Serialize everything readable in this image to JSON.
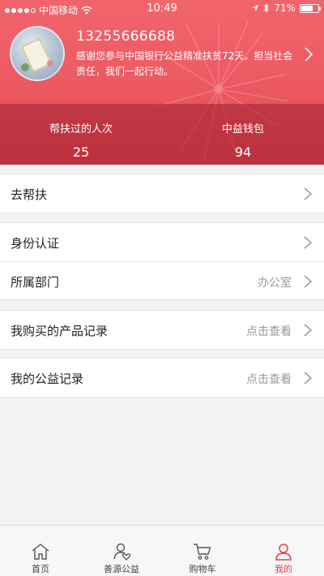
{
  "status_bar": {
    "carrier": "中国移动",
    "time": "10:49",
    "battery": "71%",
    "battery_level": 0.71
  },
  "profile": {
    "phone": "13255666688",
    "message": "感谢您参与中国银行公益精准扶贫72天。担当社会责任，我们一起行动。"
  },
  "stats": [
    {
      "label": "帮扶过的人次",
      "value": "25"
    },
    {
      "label": "中益钱包",
      "value": "94"
    }
  ],
  "menu": {
    "help": {
      "label": "去帮扶"
    },
    "identity": {
      "label": "身份认证"
    },
    "department": {
      "label": "所属部门",
      "value": "办公室"
    },
    "purchases": {
      "label": "我购买的产品记录",
      "action": "点击查看"
    },
    "charity": {
      "label": "我的公益记录",
      "action": "点击查看"
    }
  },
  "tabbar": {
    "items": [
      {
        "label": "首页",
        "icon": "home-icon"
      },
      {
        "label": "善源公益",
        "icon": "charity-heart-person-icon"
      },
      {
        "label": "购物车",
        "icon": "cart-icon"
      },
      {
        "label": "我的",
        "icon": "person-icon"
      }
    ],
    "active_index": 3,
    "active_color": "#e8394a"
  },
  "colors": {
    "header_red": "#ee5c65",
    "stats_overlay": "#a01e2d"
  }
}
